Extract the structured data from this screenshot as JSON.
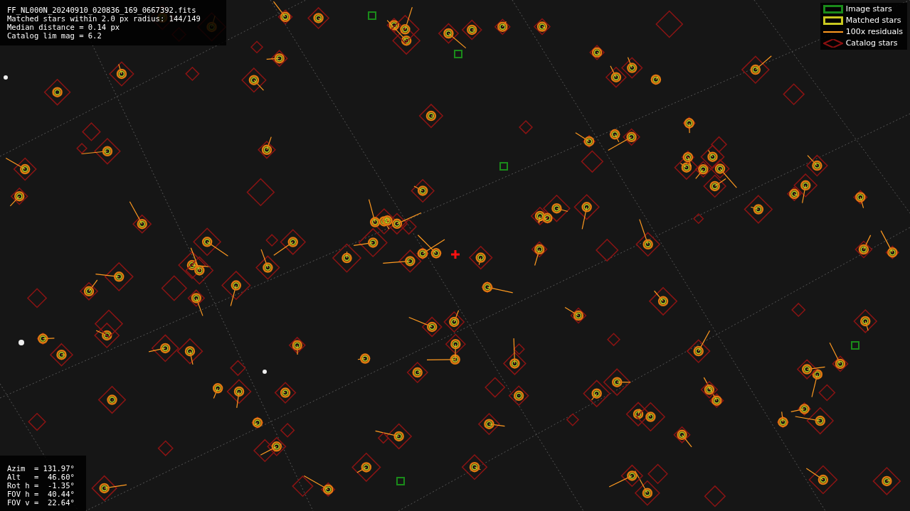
{
  "info_top": [
    "FF_NL000N_20240910_020836_169_0667392.fits",
    "Matched stars within 2.0 px radius: 144/149",
    "Median distance = 0.14 px",
    "Catalog lim mag = 6.2"
  ],
  "legend": [
    {
      "kind": "box",
      "color": "#1a8a1a",
      "label": "Image stars"
    },
    {
      "kind": "box",
      "color": "#c8c820",
      "label": "Matched stars"
    },
    {
      "kind": "line",
      "color": "#ff9a20",
      "label": "100x residuals"
    },
    {
      "kind": "diamond",
      "color": "#8a1010",
      "label": "Catalog stars"
    }
  ],
  "pointing": [
    "Azim  = 131.97°",
    "Alt   =  46.60°",
    "Rot h =  -1.35°",
    "FOV h =  40.44°",
    "FOV v =  22.64°"
  ]
}
